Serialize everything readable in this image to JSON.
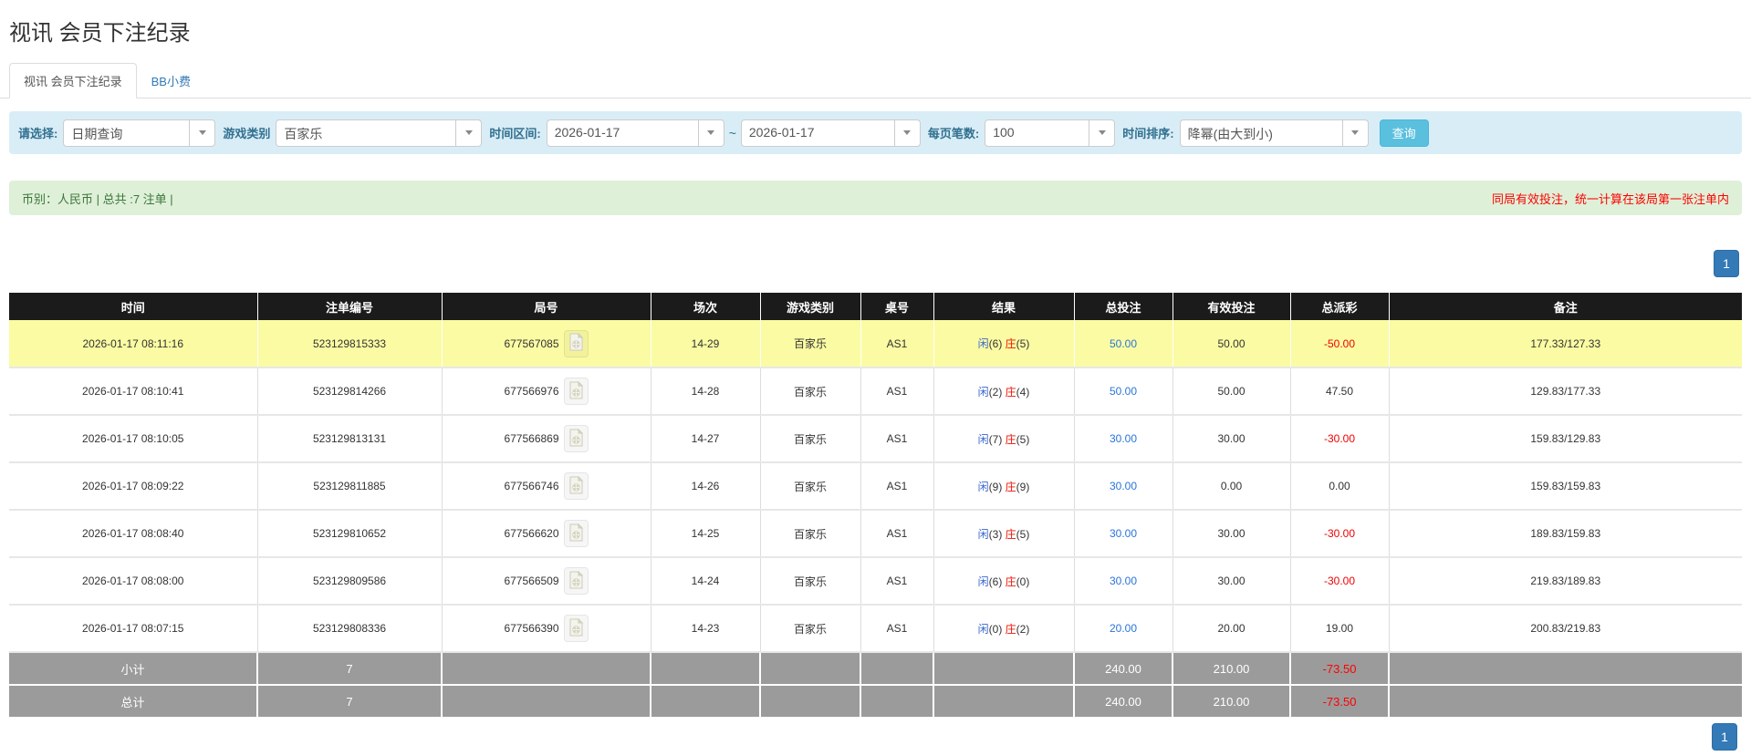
{
  "page_title": "视讯 会员下注纪录",
  "tabs": [
    {
      "label": "视讯 会员下注纪录",
      "active": true
    },
    {
      "label": "BB小费",
      "active": false
    }
  ],
  "filter": {
    "select_label": "请选择:",
    "select_value": "日期查询",
    "game_type_label": "游戏类别",
    "game_type_value": "百家乐",
    "date_range_label": "时间区间:",
    "date_from": "2026-01-17",
    "date_separator": "~",
    "date_to": "2026-01-17",
    "page_size_label": "每页笔数:",
    "page_size_value": "100",
    "sort_label": "时间排序:",
    "sort_value": "降幂(由大到小)",
    "search_button": "查询"
  },
  "info_bar": {
    "left_text": "币别：人民币 | 总共 :7 注单 |",
    "right_text": "同局有效投注，统一计算在该局第一张注单内"
  },
  "pagination": {
    "current_page": "1"
  },
  "colors": {
    "accent_blue": "#337ab7",
    "search_button": "#5bc0de",
    "filter_bg": "#d9edf7",
    "info_bg": "#dff0d8",
    "header_bg": "#1b1b1b",
    "highlight_row": "#fbfba3",
    "summary_bg": "#9b9b9b",
    "negative_red": "#ee0000",
    "link_blue": "#2a75d9",
    "player_blue": "#3a66d1",
    "banker_red": "#ee1100"
  },
  "table": {
    "columns": [
      "时间",
      "注单编号",
      "局号",
      "场次",
      "游戏类别",
      "桌号",
      "结果",
      "总投注",
      "有效投注",
      "总派彩",
      "备注"
    ],
    "rows": [
      {
        "time": "2026-01-17 08:11:16",
        "bet_id": "523129815333",
        "round_id": "677567085",
        "session": "14-29",
        "game": "百家乐",
        "table_no": "AS1",
        "result": {
          "player_label": "闲",
          "player_score": "(6)",
          "banker_label": "庄",
          "banker_score": "(5)"
        },
        "total_bet": "50.00",
        "valid_bet": "50.00",
        "payout": "-50.00",
        "remark": "177.33/127.33",
        "highlighted": true
      },
      {
        "time": "2026-01-17 08:10:41",
        "bet_id": "523129814266",
        "round_id": "677566976",
        "session": "14-28",
        "game": "百家乐",
        "table_no": "AS1",
        "result": {
          "player_label": "闲",
          "player_score": "(2)",
          "banker_label": "庄",
          "banker_score": "(4)"
        },
        "total_bet": "50.00",
        "valid_bet": "50.00",
        "payout": "47.50",
        "remark": "129.83/177.33",
        "highlighted": false
      },
      {
        "time": "2026-01-17 08:10:05",
        "bet_id": "523129813131",
        "round_id": "677566869",
        "session": "14-27",
        "game": "百家乐",
        "table_no": "AS1",
        "result": {
          "player_label": "闲",
          "player_score": "(7)",
          "banker_label": "庄",
          "banker_score": "(5)"
        },
        "total_bet": "30.00",
        "valid_bet": "30.00",
        "payout": "-30.00",
        "remark": "159.83/129.83",
        "highlighted": false
      },
      {
        "time": "2026-01-17 08:09:22",
        "bet_id": "523129811885",
        "round_id": "677566746",
        "session": "14-26",
        "game": "百家乐",
        "table_no": "AS1",
        "result": {
          "player_label": "闲",
          "player_score": "(9)",
          "banker_label": "庄",
          "banker_score": "(9)"
        },
        "total_bet": "30.00",
        "valid_bet": "0.00",
        "payout": "0.00",
        "remark": "159.83/159.83",
        "highlighted": false
      },
      {
        "time": "2026-01-17 08:08:40",
        "bet_id": "523129810652",
        "round_id": "677566620",
        "session": "14-25",
        "game": "百家乐",
        "table_no": "AS1",
        "result": {
          "player_label": "闲",
          "player_score": "(3)",
          "banker_label": "庄",
          "banker_score": "(5)"
        },
        "total_bet": "30.00",
        "valid_bet": "30.00",
        "payout": "-30.00",
        "remark": "189.83/159.83",
        "highlighted": false
      },
      {
        "time": "2026-01-17 08:08:00",
        "bet_id": "523129809586",
        "round_id": "677566509",
        "session": "14-24",
        "game": "百家乐",
        "table_no": "AS1",
        "result": {
          "player_label": "闲",
          "player_score": "(6)",
          "banker_label": "庄",
          "banker_score": "(0)"
        },
        "total_bet": "30.00",
        "valid_bet": "30.00",
        "payout": "-30.00",
        "remark": "219.83/189.83",
        "highlighted": false
      },
      {
        "time": "2026-01-17 08:07:15",
        "bet_id": "523129808336",
        "round_id": "677566390",
        "session": "14-23",
        "game": "百家乐",
        "table_no": "AS1",
        "result": {
          "player_label": "闲",
          "player_score": "(0)",
          "banker_label": "庄",
          "banker_score": "(2)"
        },
        "total_bet": "20.00",
        "valid_bet": "20.00",
        "payout": "19.00",
        "remark": "200.83/219.83",
        "highlighted": false
      }
    ],
    "summary_rows": [
      {
        "label": "小计",
        "count": "7",
        "total_bet": "240.00",
        "valid_bet": "210.00",
        "payout": "-73.50"
      },
      {
        "label": "总计",
        "count": "7",
        "total_bet": "240.00",
        "valid_bet": "210.00",
        "payout": "-73.50"
      }
    ]
  }
}
